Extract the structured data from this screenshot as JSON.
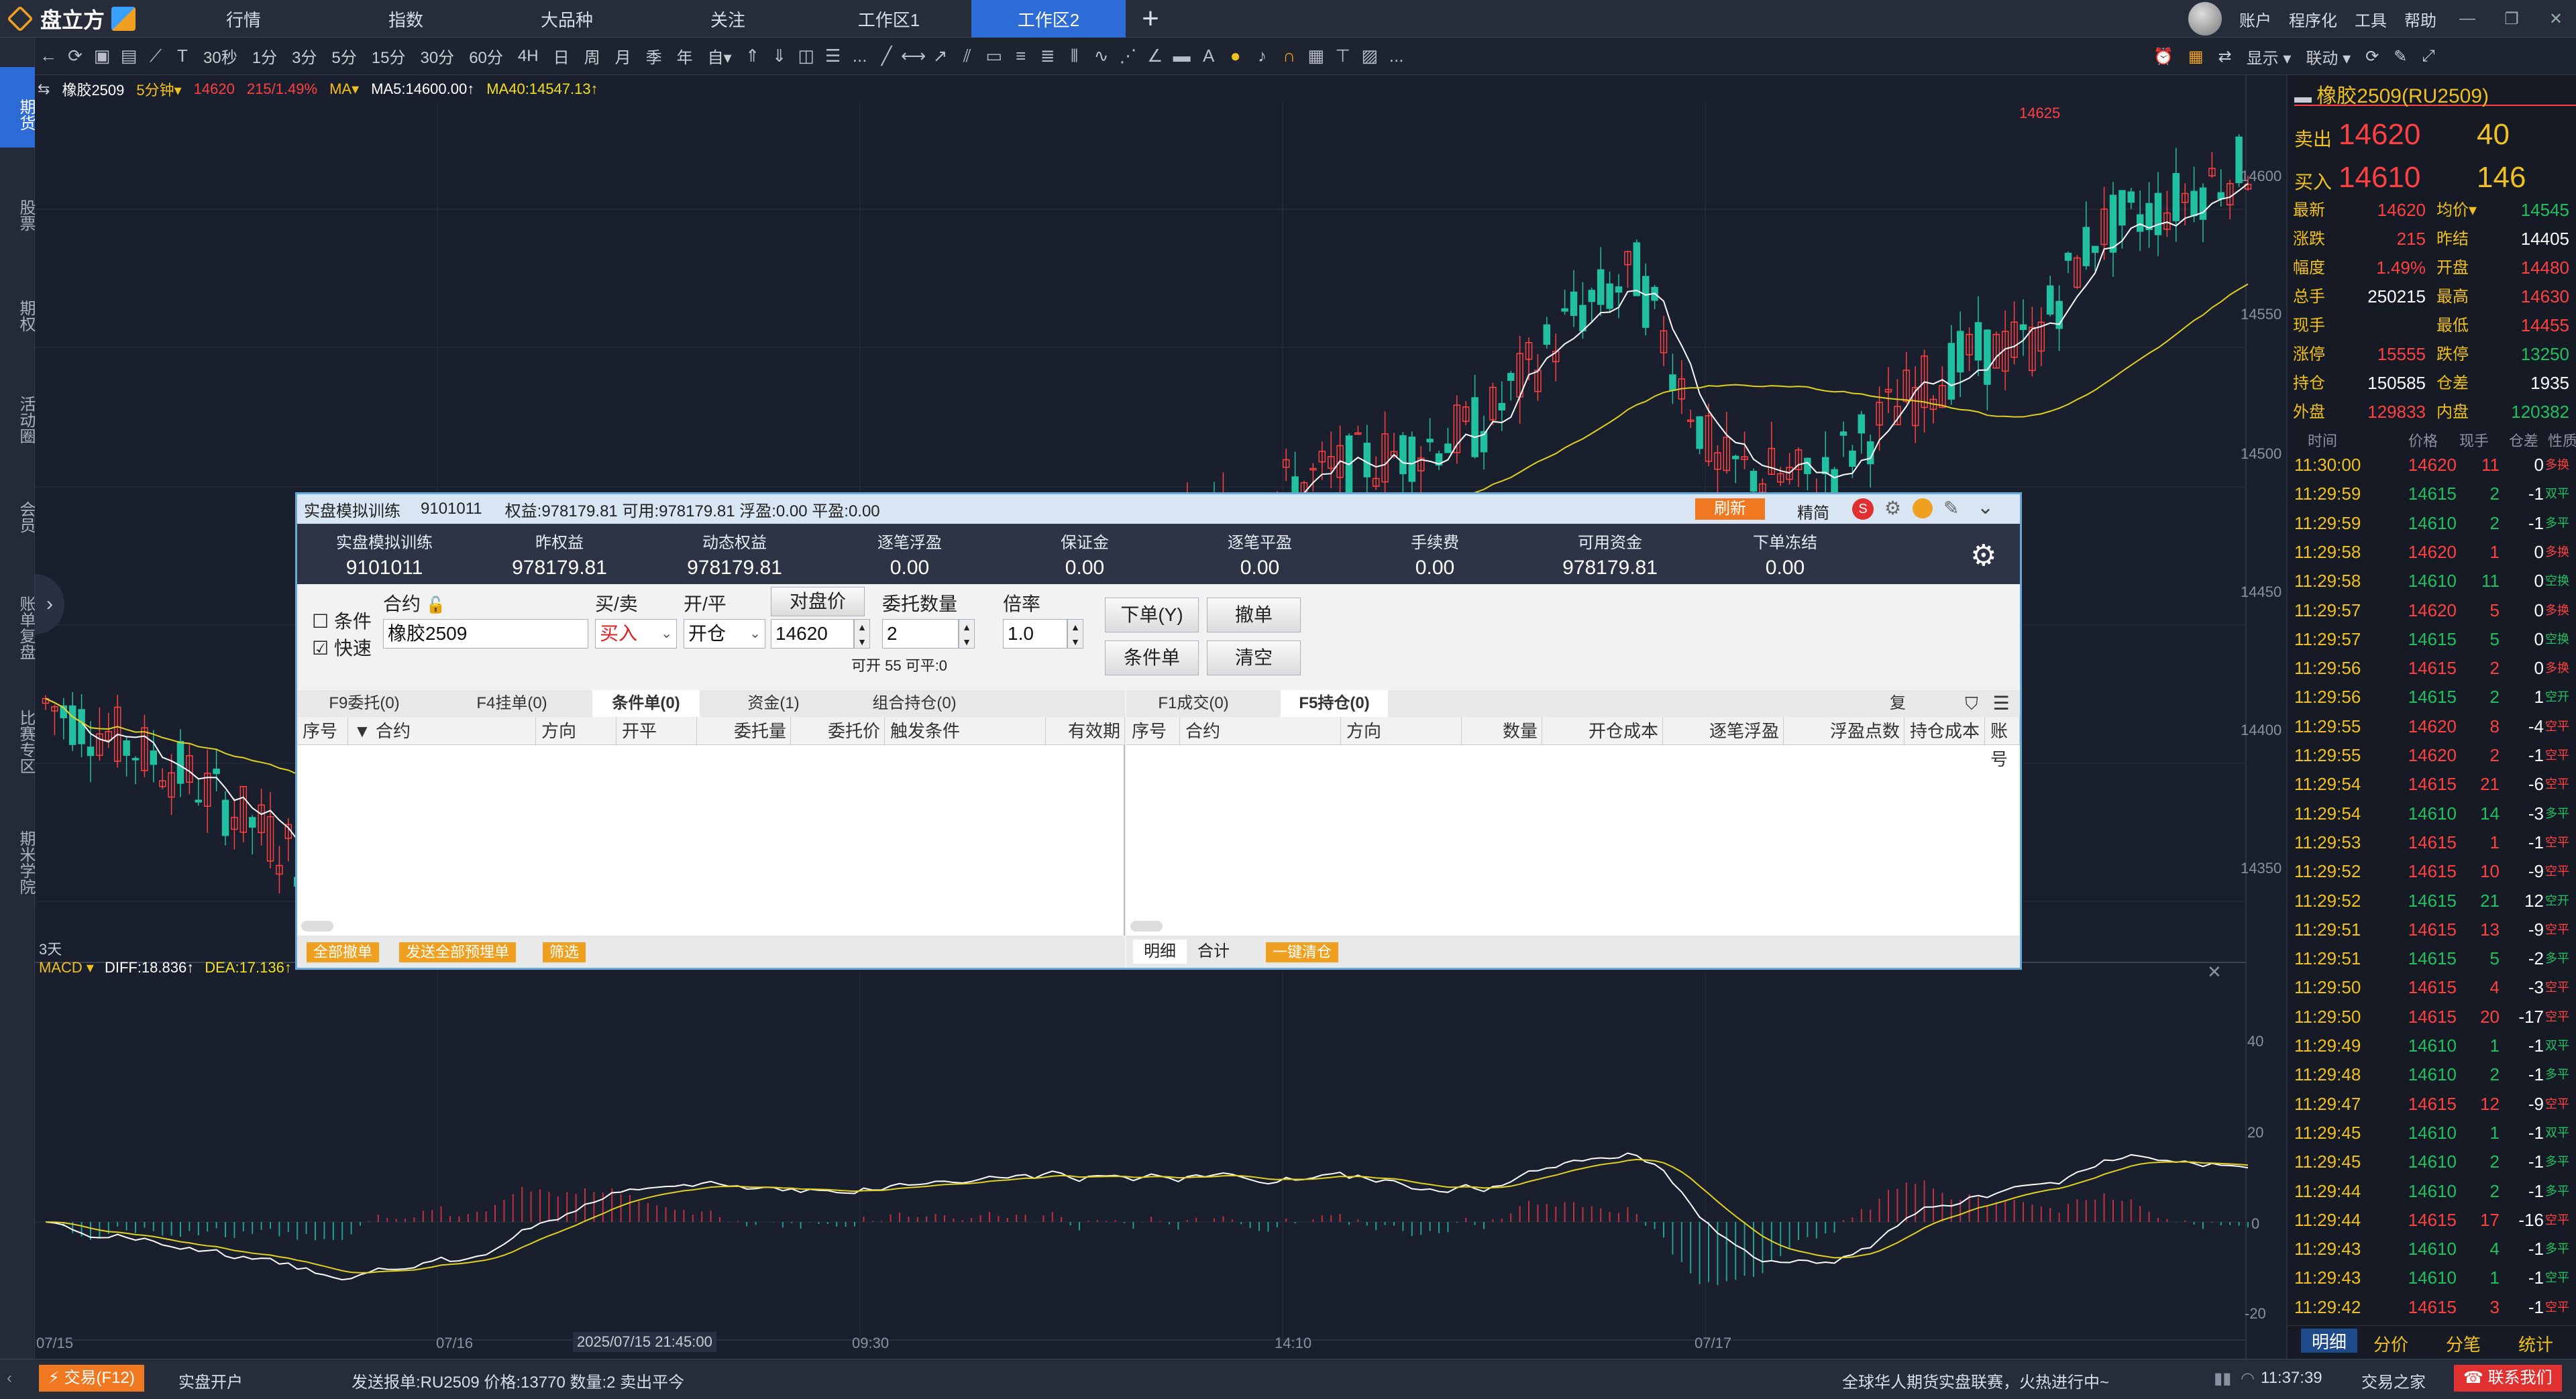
{
  "app": {
    "name": "盘立方"
  },
  "nav_tabs": [
    "行情",
    "指数",
    "大品种",
    "关注",
    "工作区1",
    "工作区2"
  ],
  "active_tab": "工作区2",
  "right_menu": [
    "账户",
    "程序化",
    "工具",
    "帮助"
  ],
  "toolbar": {
    "periods": [
      "30秒",
      "1分",
      "3分",
      "5分",
      "15分",
      "30分",
      "60分",
      "4H",
      "日",
      "周",
      "月",
      "季",
      "年",
      "自▾"
    ],
    "trailing_text": "..."
  },
  "sidebar": [
    {
      "id": "futures",
      "label": "期货",
      "active": true
    },
    {
      "id": "stocks",
      "label": "股票"
    },
    {
      "id": "options",
      "label": "期权"
    },
    {
      "id": "activity",
      "label": "活动圈"
    },
    {
      "id": "member",
      "label": "会员"
    },
    {
      "id": "review",
      "label": "账单复盘"
    },
    {
      "id": "match",
      "label": "比赛专区"
    },
    {
      "id": "academy",
      "label": "期米学院"
    }
  ],
  "chart_header": {
    "symbol": "橡胶2509",
    "period": "5分钟▾",
    "price": "14620",
    "change": "215/1.49%",
    "ma_label": "MA▾",
    "ma5": "MA5:14600.00↑",
    "ma40": "MA40:14547.13↑",
    "high_marker": "14625"
  },
  "macd_header": {
    "label": "MACD ▾",
    "diff": "DIFF:18.836↑",
    "dea": "DEA:17.136↑",
    "period_tag": "3天"
  },
  "price_axis": [
    "14600",
    "14550",
    "14500",
    "14450",
    "14400",
    "14350"
  ],
  "macd_axis": [
    "40",
    "20",
    "0",
    "-20"
  ],
  "time_axis": [
    "07/15",
    "07/16",
    "2025/07/15 21:45:00",
    "09:30",
    "14:10",
    "07/17"
  ],
  "chart_data": [
    {
      "type": "candlestick",
      "title": "橡胶2509 5分钟",
      "y_range": [
        14325,
        14630
      ],
      "series": [
        {
          "name": "MA5",
          "value": 14600.0
        },
        {
          "name": "MA40",
          "value": 14547.13
        }
      ],
      "last_price": 14620,
      "high_marker": 14625
    },
    {
      "type": "line",
      "title": "MACD",
      "y_range": [
        -22,
        45
      ],
      "series": [
        {
          "name": "DIFF",
          "value": 18.836
        },
        {
          "name": "DEA",
          "value": 17.136
        }
      ]
    }
  ],
  "quote_panel": {
    "title": "橡胶2509(RU2509)",
    "sell": {
      "label": "卖出",
      "price": "14620",
      "vol": "40"
    },
    "buy": {
      "label": "买入",
      "price": "14610",
      "vol": "146"
    },
    "rows": [
      [
        {
          "k": "最新",
          "v": "14620",
          "c": "#ff4040"
        },
        {
          "k": "均价▾",
          "v": "14545",
          "c": "#20c060"
        }
      ],
      [
        {
          "k": "涨跌",
          "v": "215",
          "c": "#ff4040"
        },
        {
          "k": "昨结",
          "v": "14405",
          "c": "#ffffff"
        }
      ],
      [
        {
          "k": "幅度",
          "v": "1.49%",
          "c": "#ff4040"
        },
        {
          "k": "开盘",
          "v": "14480",
          "c": "#ff4040"
        }
      ],
      [
        {
          "k": "总手",
          "v": "250215",
          "c": "#ffffff"
        },
        {
          "k": "最高",
          "v": "14630",
          "c": "#ff4040"
        }
      ],
      [
        {
          "k": "现手",
          "v": "",
          "c": "#ffffff"
        },
        {
          "k": "最低",
          "v": "14455",
          "c": "#ff4040"
        }
      ],
      [
        {
          "k": "涨停",
          "v": "15555",
          "c": "#ff4040"
        },
        {
          "k": "跌停",
          "v": "13250",
          "c": "#20c060"
        }
      ],
      [
        {
          "k": "持仓",
          "v": "150585",
          "c": "#ffffff"
        },
        {
          "k": "仓差",
          "v": "1935",
          "c": "#ffffff"
        }
      ],
      [
        {
          "k": "外盘",
          "v": "129833",
          "c": "#ff4040"
        },
        {
          "k": "内盘",
          "v": "120382",
          "c": "#20c060"
        }
      ]
    ],
    "tick_headers": [
      "时间",
      "价格",
      "现手",
      "仓差",
      "性质"
    ],
    "ticks": [
      [
        "11:30:00",
        "14620",
        "11",
        "0",
        "多换",
        "r"
      ],
      [
        "11:29:59",
        "14615",
        "2",
        "-1",
        "双平",
        "g"
      ],
      [
        "11:29:59",
        "14610",
        "2",
        "-1",
        "多平",
        "g"
      ],
      [
        "11:29:58",
        "14620",
        "1",
        "0",
        "多换",
        "r"
      ],
      [
        "11:29:58",
        "14610",
        "11",
        "0",
        "空换",
        "g"
      ],
      [
        "11:29:57",
        "14620",
        "5",
        "0",
        "多换",
        "r"
      ],
      [
        "11:29:57",
        "14615",
        "5",
        "0",
        "空换",
        "g"
      ],
      [
        "11:29:56",
        "14615",
        "2",
        "0",
        "多换",
        "r"
      ],
      [
        "11:29:56",
        "14615",
        "2",
        "1",
        "空开",
        "g"
      ],
      [
        "11:29:55",
        "14620",
        "8",
        "-4",
        "空平",
        "r"
      ],
      [
        "11:29:55",
        "14620",
        "2",
        "-1",
        "空平",
        "r"
      ],
      [
        "11:29:54",
        "14615",
        "21",
        "-6",
        "空平",
        "r"
      ],
      [
        "11:29:54",
        "14610",
        "14",
        "-3",
        "多平",
        "g"
      ],
      [
        "11:29:53",
        "14615",
        "1",
        "-1",
        "空平",
        "r"
      ],
      [
        "11:29:52",
        "14615",
        "10",
        "-9",
        "空平",
        "r"
      ],
      [
        "11:29:52",
        "14615",
        "21",
        "12",
        "空开",
        "g"
      ],
      [
        "11:29:51",
        "14615",
        "13",
        "-9",
        "空平",
        "r"
      ],
      [
        "11:29:51",
        "14615",
        "5",
        "-2",
        "多平",
        "g"
      ],
      [
        "11:29:50",
        "14615",
        "4",
        "-3",
        "空平",
        "r"
      ],
      [
        "11:29:50",
        "14615",
        "20",
        "-17",
        "空平",
        "r"
      ],
      [
        "11:29:49",
        "14610",
        "1",
        "-1",
        "双平",
        "g"
      ],
      [
        "11:29:48",
        "14610",
        "2",
        "-1",
        "多平",
        "g"
      ],
      [
        "11:29:47",
        "14615",
        "12",
        "-9",
        "空平",
        "r"
      ],
      [
        "11:29:45",
        "14610",
        "1",
        "-1",
        "双平",
        "g"
      ],
      [
        "11:29:45",
        "14610",
        "2",
        "-1",
        "多平",
        "g"
      ],
      [
        "11:29:44",
        "14610",
        "2",
        "-1",
        "多平",
        "g"
      ],
      [
        "11:29:44",
        "14615",
        "17",
        "-16",
        "空平",
        "r"
      ],
      [
        "11:29:43",
        "14610",
        "4",
        "-1",
        "多平",
        "g"
      ],
      [
        "11:29:43",
        "14610",
        "1",
        "-1",
        "空平",
        "g"
      ],
      [
        "11:29:42",
        "14615",
        "3",
        "-1",
        "空平",
        "r"
      ]
    ],
    "bottom_tabs": [
      "明细",
      "分价",
      "分笔",
      "统计"
    ]
  },
  "dialog": {
    "title": "实盘模拟训练",
    "account": "9101011",
    "summary": "权益:978179.81  可用:978179.81  浮盈:0.00 平盈:0.00",
    "refresh": "刷新",
    "mode": "精简",
    "stats": [
      {
        "label": "实盘模拟训练",
        "value": "9101011"
      },
      {
        "label": "昨权益",
        "value": "978179.81"
      },
      {
        "label": "动态权益",
        "value": "978179.81"
      },
      {
        "label": "逐笔浮盈",
        "value": "0.00"
      },
      {
        "label": "保证金",
        "value": "0.00"
      },
      {
        "label": "逐笔平盈",
        "value": "0.00"
      },
      {
        "label": "手续费",
        "value": "0.00"
      },
      {
        "label": "可用资金",
        "value": "978179.81"
      },
      {
        "label": "下单冻结",
        "value": "0.00"
      }
    ],
    "order": {
      "cond_label": "条件",
      "fast_label": "快速",
      "contract_label": "合约",
      "contract": "橡胶2509",
      "side_label": "买/卖",
      "side": "买入",
      "open_label": "开/平",
      "open": "开仓",
      "price_btn": "对盘价",
      "price": "14620",
      "qty_label": "委托数量",
      "qty": "2",
      "mult_label": "倍率",
      "mult": "1.0",
      "available": "可开 55  可平:0",
      "place": "下单(Y)",
      "cancel": "撤单",
      "cond_order": "条件单",
      "clear": "清空"
    },
    "left_tabs": [
      "F9委托(0)",
      "F4挂单(0)",
      "条件单(0)",
      "资金(1)",
      "组合持仓(0)"
    ],
    "left_headers": [
      "序号",
      "合约",
      "方向",
      "开平",
      "委托量",
      "委托价",
      "触发条件",
      "有效期"
    ],
    "left_footer": [
      "全部撤单",
      "发送全部预埋单",
      "筛选"
    ],
    "right_tabs": [
      "F1成交(0)",
      "F5持仓(0)",
      "复"
    ],
    "right_headers": [
      "序号",
      "合约",
      "方向",
      "数量",
      "开仓成本",
      "逐笔浮盈",
      "浮盈点数",
      "持仓成本",
      "账号"
    ],
    "right_footer": [
      "明细",
      "合计",
      "一键清仓"
    ]
  },
  "bottom_bar": {
    "trade": "交易(F12)",
    "open_account": "实盘开户",
    "message": "发送报单:RU2509 价格:13770  数量:2 卖出平今",
    "promo": "全球华人期货实盘联赛，火热进行中~",
    "time": "11:37:39",
    "home": "交易之家",
    "contact": "联系我们"
  },
  "colors": {
    "up": "#ff4040",
    "down": "#20c0a0",
    "accent": "#2d6bd6",
    "orange": "#f0a020"
  }
}
